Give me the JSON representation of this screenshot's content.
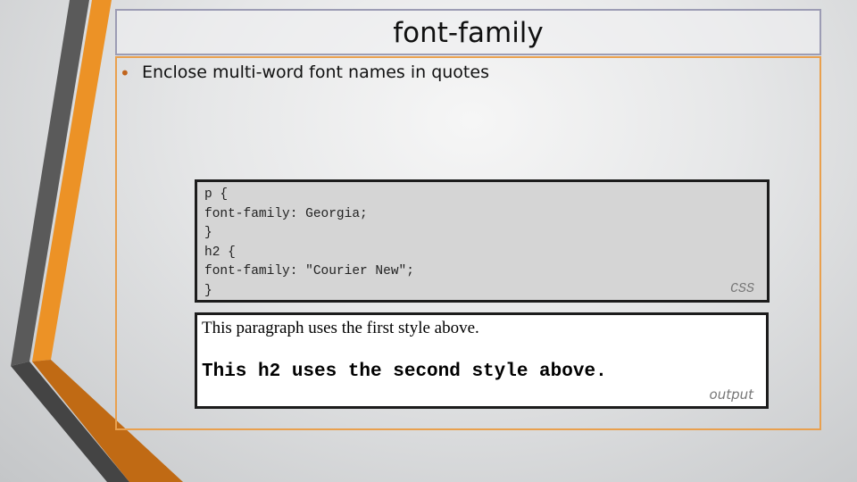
{
  "slide": {
    "title": "font-family",
    "bullet": "Enclose multi-word font names in quotes",
    "code": "p {\nfont-family: Georgia;\n}\nh2 {\nfont-family: \"Courier New\";\n}",
    "code_label": "CSS",
    "output_paragraph": "This paragraph uses the first style above.",
    "output_h2": "This h2 uses the second style above.",
    "output_label": "output"
  },
  "colors": {
    "accent": "#e8901f",
    "dark": "#555555"
  }
}
